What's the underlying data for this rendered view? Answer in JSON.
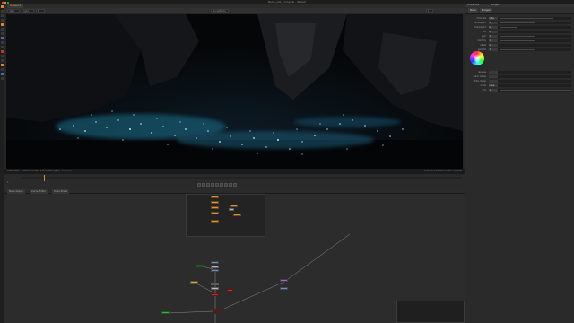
{
  "window": {
    "title": "Nuke_v01_comp.nk - NukeX"
  },
  "viewer_tab": {
    "label": "Viewer1"
  },
  "viewer_controls": {
    "layer_label": "rgba",
    "channel_value": "rgba",
    "zoom": "1",
    "input": "MergeNode",
    "frame_field": "1"
  },
  "viewer_info": {
    "left": "1920x1080 · 2048x1152 bbox 1920x1080 (rgba) · x=0 y=0",
    "right": "0.12345 0.23456 0.34567 1.00000"
  },
  "timeline": {
    "frame_label": "1",
    "fps": "24",
    "end_label": "100"
  },
  "node_tabs": [
    {
      "label": "Node Graph"
    },
    {
      "label": "Curve Editor"
    },
    {
      "label": "Dope Sheet"
    }
  ],
  "properties": {
    "panel_title": "Properties",
    "node_title": "Merge2",
    "tabs": [
      {
        "label": "Node"
      },
      {
        "label": "Merge2"
      }
    ],
    "rows": [
      {
        "label": "channels",
        "value": "rgba"
      },
      {
        "label": "whitepoint",
        "value": "1"
      },
      {
        "label": "blackpoint",
        "value": "0"
      },
      {
        "label": "lift",
        "value": "0"
      },
      {
        "label": "gain",
        "value": "1"
      },
      {
        "label": "multiply",
        "value": "1"
      },
      {
        "label": "offset",
        "value": "0"
      },
      {
        "label": "gamma",
        "value": "1"
      },
      {
        "label": "reverse",
        "value": ""
      },
      {
        "label": "black clamp",
        "value": ""
      },
      {
        "label": "white clamp",
        "value": ""
      },
      {
        "label": "mask",
        "value": "none"
      },
      {
        "label": "mix",
        "value": "1"
      }
    ]
  },
  "colors": {
    "accent": "#e08a2e",
    "viewer_bg": "#060708",
    "panel_bg": "#2a2a2a"
  }
}
